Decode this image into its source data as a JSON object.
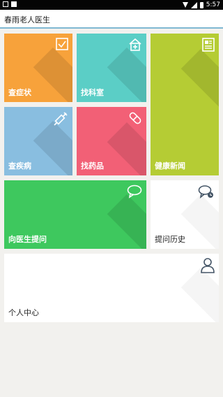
{
  "status_bar": {
    "time": "5:57",
    "icons": [
      "notification-icon",
      "app-notification-icon",
      "wifi-icon",
      "signal-icon",
      "battery-icon"
    ]
  },
  "header": {
    "title": "春雨老人医生"
  },
  "tiles": [
    {
      "label": "查症状",
      "icon": "checkbox-icon",
      "color": "#f7a23b"
    },
    {
      "label": "找科室",
      "icon": "hospital-icon",
      "color": "#5bcec6"
    },
    {
      "label": "健康新闻",
      "icon": "newspaper-icon",
      "color": "#b5cc34"
    },
    {
      "label": "查疾病",
      "icon": "syringe-icon",
      "color": "#89bee0"
    },
    {
      "label": "找药品",
      "icon": "pill-icon",
      "color": "#f26076"
    },
    {
      "label": "向医生提问",
      "icon": "chat-bubble-icon",
      "color": "#3ec85e"
    },
    {
      "label": "提问历史",
      "icon": "chat-history-icon",
      "color": "#ffffff"
    },
    {
      "label": "个人中心",
      "icon": "person-icon",
      "color": "#ffffff"
    }
  ]
}
